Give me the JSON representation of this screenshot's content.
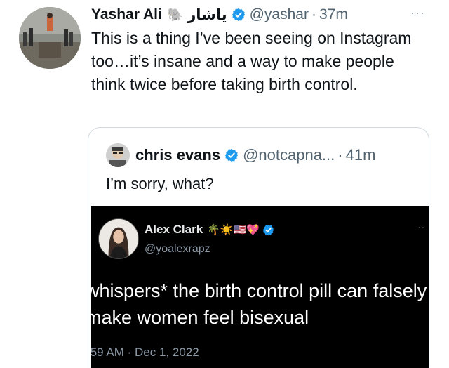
{
  "main_tweet": {
    "display_name": "Yashar Ali",
    "name_emoji": "🐘",
    "arabic_name": "یاشار",
    "handle": "@yashar",
    "separator": "·",
    "time": "37m",
    "more": "···",
    "text": "This is a thing I’ve been seeing on Instagram too…it’s insane and a way to make people think twice before taking birth control.",
    "verified_color": "#1d9bf0"
  },
  "quote_tweet": {
    "display_name": "chris evans",
    "handle": "@notcapna...",
    "separator": "·",
    "time": "41m",
    "text": "I’m sorry, what?"
  },
  "embedded_tweet": {
    "display_name": "Alex Clark",
    "emojis": "🌴☀️🇺🇸💖",
    "handle": "@yoalexrapz",
    "more": "··",
    "text": "whispers* the birth control pill can falsely make women feel bisexual",
    "timestamp": ":59 AM · Dec 1, 2022"
  }
}
